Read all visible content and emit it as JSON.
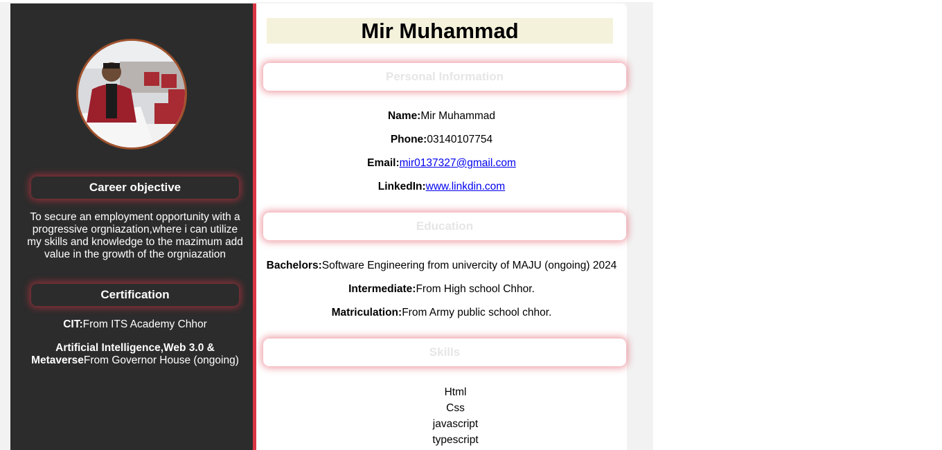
{
  "colors": {
    "sidebar_bg": "#2c2c2c",
    "accent_red": "#dc3545",
    "banner_bg": "#f5f2dc",
    "link": "#0000ee"
  },
  "sidebar": {
    "photo_alt": "profile-photo",
    "career_heading": "Career objective",
    "career_text": "To secure an employment opportunity with a progressive orgniazation,where i can utilize my skills and knowledge to the mazimum add value in the growth of the orgniazation",
    "certification_heading": "Certification",
    "certifications": [
      {
        "label": "CIT:",
        "text": "From ITS Academy Chhor"
      },
      {
        "label": "Artificial Intelligence,Web 3.0 & Metaverse",
        "text": "From Governor House (ongoing)"
      }
    ]
  },
  "main": {
    "name": "Mir Muhammad",
    "personal_heading": "Personal Information",
    "personal": {
      "name_label": "Name:",
      "name_value": "Mir Muhammad",
      "phone_label": "Phone:",
      "phone_value": "03140107754",
      "email_label": "Email:",
      "email_value": "mir0137327@gmail.com",
      "linkedin_label": "LinkedIn:",
      "linkedin_value": "www.linkdin.com"
    },
    "education_heading": "Education",
    "education": [
      {
        "label": "Bachelors:",
        "text": "Software Engineering from univercity of MAJU (ongoing) 2024"
      },
      {
        "label": "Intermediate:",
        "text": "From High school Chhor."
      },
      {
        "label": "Matriculation:",
        "text": "From Army public school chhor."
      }
    ],
    "skills_heading": "Skills",
    "skills": [
      "Html",
      "Css",
      "javascript",
      "typescript"
    ]
  }
}
